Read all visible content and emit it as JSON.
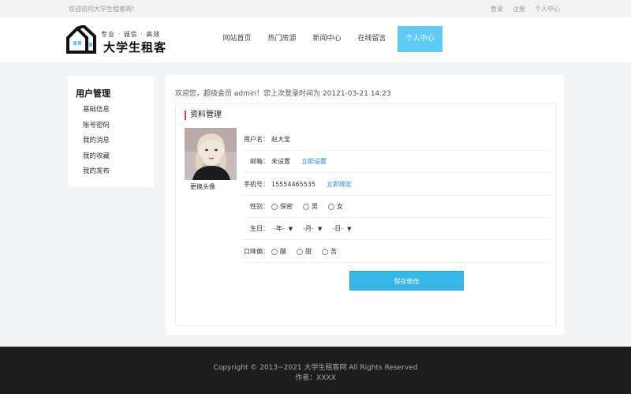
{
  "topbar": {
    "welcome": "欢迎访问大学生租客网!",
    "links": [
      "登录",
      "注册",
      "个人中心"
    ]
  },
  "logo": {
    "slogan": "专业 · 诚信 · 高效",
    "brand": "大学生租客"
  },
  "nav": {
    "items": [
      "网站首页",
      "热门房源",
      "新闻中心",
      "在线留言",
      "个人中心"
    ],
    "active_index": 4
  },
  "sidebar": {
    "title": "用户管理",
    "items": [
      "基础信息",
      "账号密码",
      "我的消息",
      "我的收藏",
      "我的发布"
    ]
  },
  "main": {
    "last_login": "欢迎您，超级会员 admin！您上次登录时间为 20121-03-21 14:23",
    "panel_title": "资料管理",
    "avatar_link": "更换头像",
    "username_label": "用户名：",
    "username_value": "赵大宝",
    "email_label": "邮箱：",
    "email_value": "未设置",
    "email_link": "立即设置",
    "phone_label": "手机号：",
    "phone_value": "15554465535",
    "phone_link": "立即绑定",
    "gender_label": "性别：",
    "gender_options": [
      "保密",
      "男",
      "女"
    ],
    "birthday_label": "生日：",
    "birthday_selects": [
      "-年-",
      "-月-",
      "-日-"
    ],
    "taste_label": "口味偏：",
    "taste_options": [
      "酸",
      "甜",
      "苦"
    ],
    "save_label": "保存修改"
  },
  "footer": {
    "copyright": "Copyright © 2013~2021 大学生租客网 All Rights Reserved",
    "author": "作者：XXXX"
  },
  "colors": {
    "accent": "#5ecbf5",
    "button": "#36b7e8",
    "link": "#1e88e5",
    "title_bar": "#e5383b",
    "footer_bg": "#1d1d1d"
  }
}
